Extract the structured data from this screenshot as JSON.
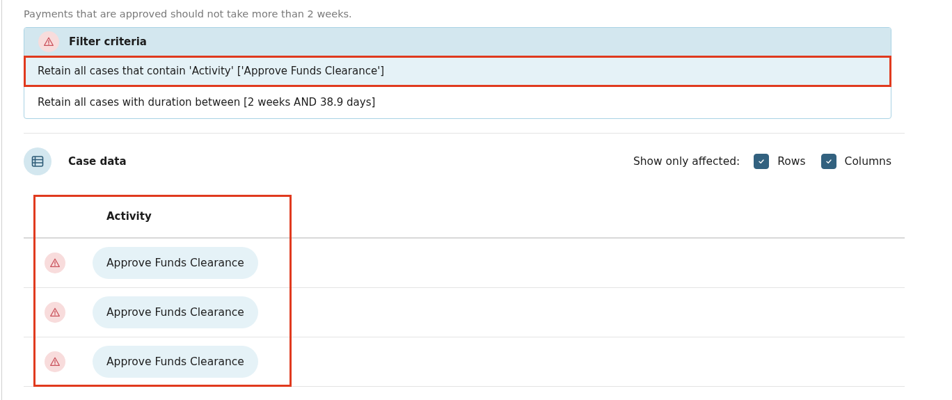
{
  "description": "Payments that are approved should not take more than 2 weeks.",
  "filter_criteria": {
    "title": "Filter criteria",
    "warning": true,
    "items": [
      {
        "text": "Retain all cases that contain 'Activity' ['Approve Funds Clearance']",
        "highlighted": true
      },
      {
        "text": "Retain all cases with duration between [2 weeks AND 38.9 days]",
        "highlighted": false
      }
    ]
  },
  "case_data": {
    "title": "Case data",
    "show_only_affected": {
      "label": "Show only affected:",
      "options": [
        {
          "label": "Rows",
          "checked": true
        },
        {
          "label": "Columns",
          "checked": true
        }
      ]
    },
    "table": {
      "highlighted": true,
      "columns": [
        "Activity"
      ],
      "rows": [
        {
          "warning": true,
          "activity": "Approve Funds Clearance"
        },
        {
          "warning": true,
          "activity": "Approve Funds Clearance"
        },
        {
          "warning": true,
          "activity": "Approve Funds Clearance"
        }
      ]
    }
  }
}
